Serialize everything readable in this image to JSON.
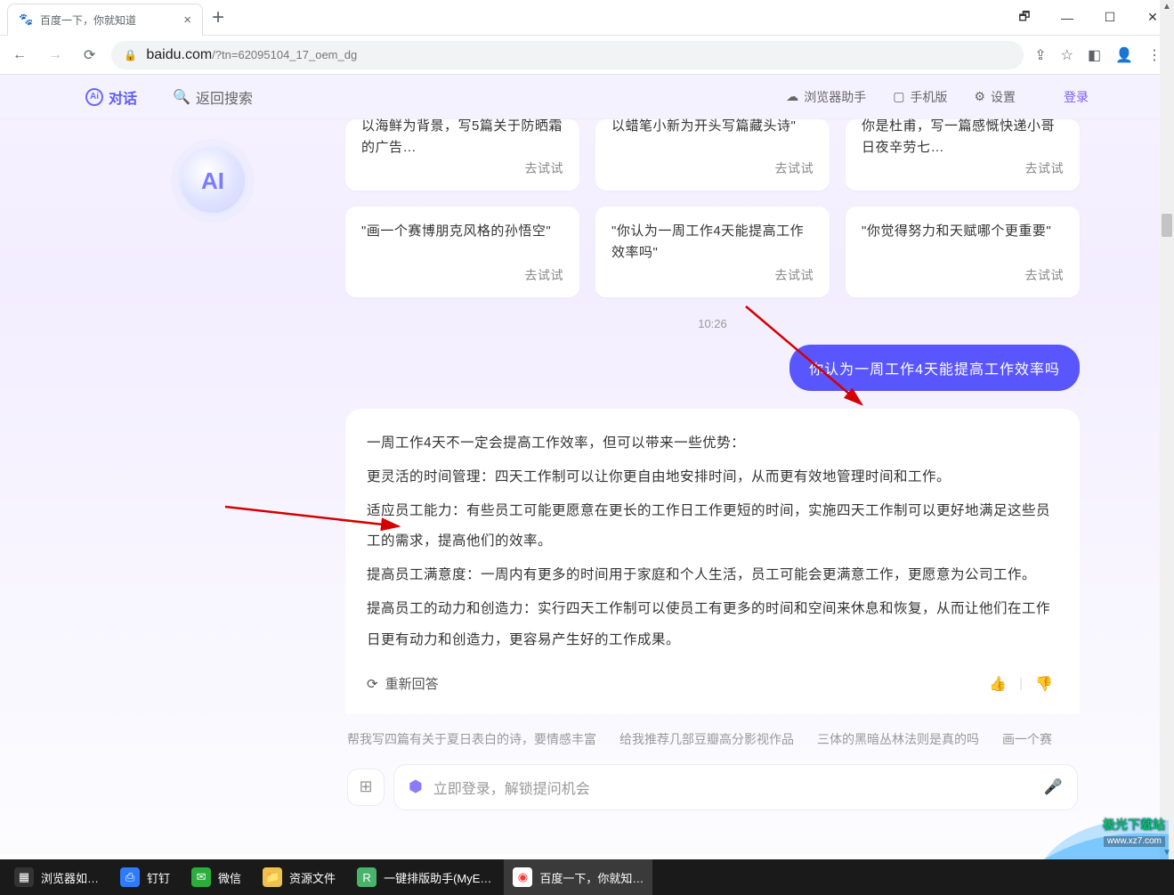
{
  "browser": {
    "tab_title": "百度一下，你就知道",
    "url_domain": "baidu.com",
    "url_path": "/?tn=62095104_17_oem_dg",
    "window": {
      "min": "—",
      "down": "❐",
      "max": "☐",
      "close": "✕"
    }
  },
  "header": {
    "chat": "对话",
    "back_search": "返回搜索",
    "helper": "浏览器助手",
    "mobile": "手机版",
    "settings": "设置",
    "login": "登录"
  },
  "avatar": "AI",
  "cards_row1": [
    {
      "text": "以海鲜为背景，写5篇关于防晒霜的广告…",
      "try": "去试试"
    },
    {
      "text": "以蜡笔小新为开头写篇藏头诗\"",
      "try": "去试试"
    },
    {
      "text": "你是杜甫，写一篇感慨快递小哥日夜辛劳七…",
      "try": "去试试"
    }
  ],
  "cards_row2": [
    {
      "text": "\"画一个赛博朋克风格的孙悟空\"",
      "try": "去试试"
    },
    {
      "text": "\"你认为一周工作4天能提高工作效率吗\"",
      "try": "去试试"
    },
    {
      "text": "\"你觉得努力和天赋哪个更重要\"",
      "try": "去试试"
    }
  ],
  "time": "10:26",
  "user_msg": "你认为一周工作4天能提高工作效率吗",
  "ai_msg": [
    "一周工作4天不一定会提高工作效率，但可以带来一些优势：",
    "更灵活的时间管理：四天工作制可以让你更自由地安排时间，从而更有效地管理时间和工作。",
    "适应员工能力：有些员工可能更愿意在更长的工作日工作更短的时间，实施四天工作制可以更好地满足这些员工的需求，提高他们的效率。",
    "提高员工满意度：一周内有更多的时间用于家庭和个人生活，员工可能会更满意工作，更愿意为公司工作。",
    "提高员工的动力和创造力：实行四天工作制可以使员工有更多的时间和空间来休息和恢复，从而让他们在工作日更有动力和创造力，更容易产生好的工作成果。"
  ],
  "regen": "重新回答",
  "suggestions": [
    "帮我写四篇有关于夏日表白的诗，要情感丰富",
    "给我推荐几部豆瓣高分影视作品",
    "三体的黑暗丛林法则是真的吗",
    "画一个赛"
  ],
  "input_placeholder": "立即登录，解锁提问机会",
  "taskbar": [
    {
      "label": "浏览器如…",
      "color": "#222"
    },
    {
      "label": "钉钉",
      "color": "#2e7bff"
    },
    {
      "label": "微信",
      "color": "#3ab54a"
    },
    {
      "label": "资源文件",
      "color": "#f0c24b"
    },
    {
      "label": "一键排版助手(MyE…",
      "color": "#47b36b"
    },
    {
      "label": "百度一下，你就知…",
      "color": "#fff"
    }
  ],
  "watermark": {
    "l1": "极光下载站",
    "l2": "www.xz7.com"
  }
}
